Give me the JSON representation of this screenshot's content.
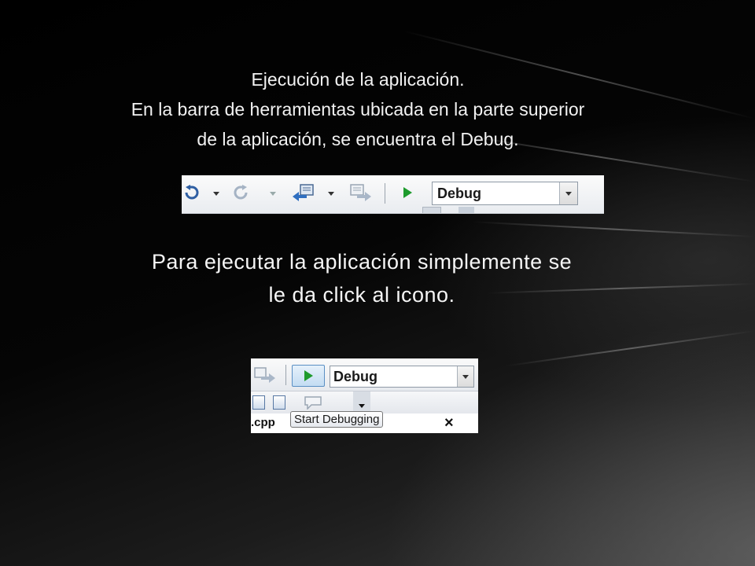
{
  "slide": {
    "heading_lines": [
      "Ejecución de la aplicación.",
      "En la barra de herramientas ubicada en la parte superior",
      "de la aplicación, se encuentra el Debug."
    ],
    "body_lines": [
      "Para ejecutar la aplicación simplemente se",
      "le da click al icono."
    ]
  },
  "toolbar_top": {
    "configuration_value": "Debug",
    "icons": [
      "undo-icon",
      "redo-icon",
      "navigate-backward-icon",
      "navigate-forward-icon",
      "start-debugging-icon"
    ]
  },
  "toolbar_zoom": {
    "configuration_value": "Debug",
    "tooltip": "Start Debugging",
    "file_tab": ".cpp",
    "close_glyph": "×"
  },
  "colors": {
    "play_green": "#1e9b2d",
    "highlight_border": "#5a8fc4",
    "text": "#f2f2f2"
  }
}
